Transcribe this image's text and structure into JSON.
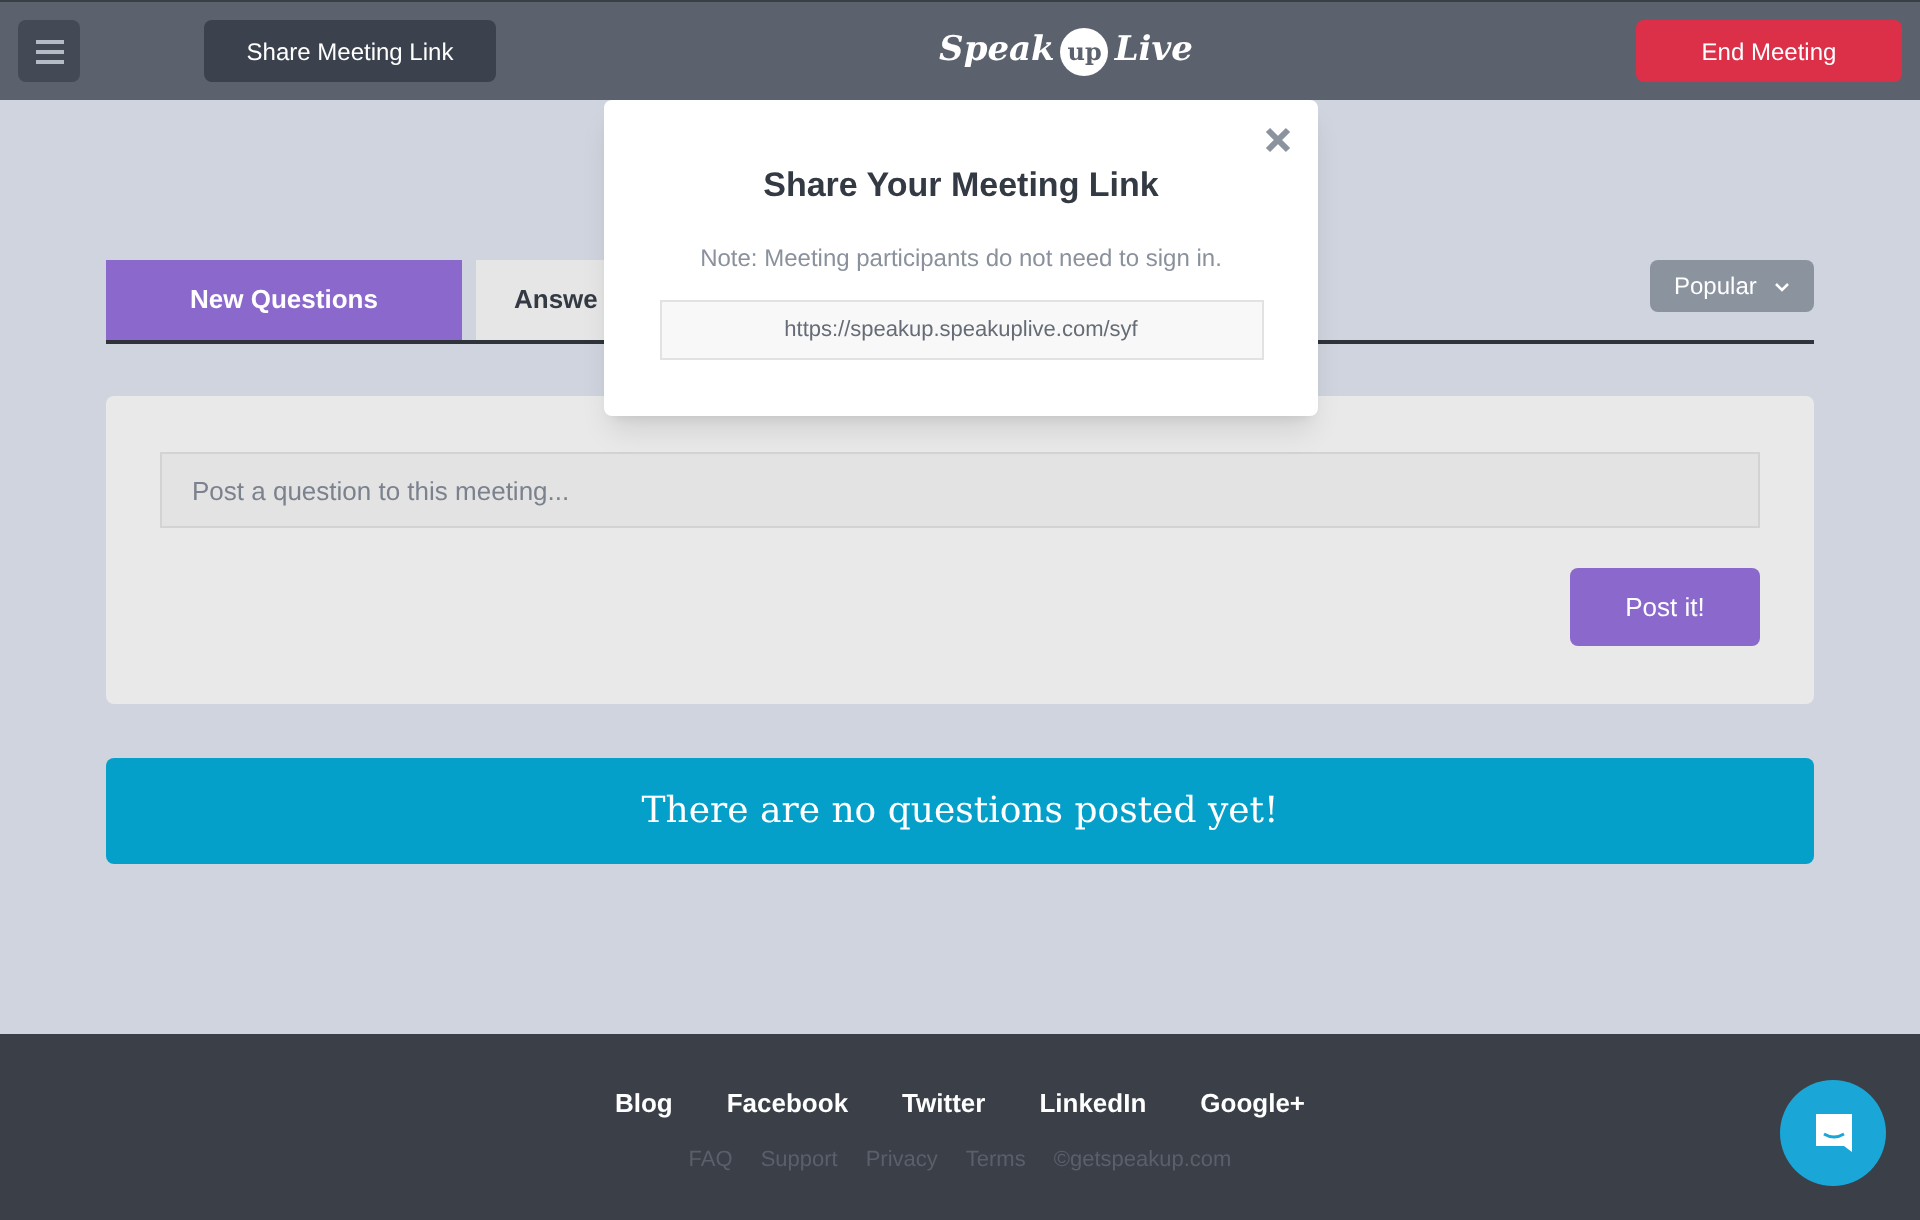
{
  "header": {
    "share_button": "Share Meeting Link",
    "logo": {
      "left": "Speak",
      "bubble": "up",
      "right": "Live"
    },
    "end_button": "End Meeting"
  },
  "tabs": [
    {
      "label": "New Questions",
      "selected": true
    },
    {
      "label": "Answe",
      "selected": false
    }
  ],
  "sort": {
    "value": "Popular"
  },
  "composer": {
    "placeholder": "Post a question to this meeting...",
    "submit": "Post it!"
  },
  "empty_notice": "There are no questions posted yet!",
  "modal": {
    "title": "Share Your Meeting Link",
    "note": "Note: Meeting participants do not need to sign in.",
    "link": "https://speakup.speakuplive.com/syf"
  },
  "footer": {
    "links": [
      "Blog",
      "Facebook",
      "Twitter",
      "LinkedIn",
      "Google+"
    ],
    "secondary_links": [
      "FAQ",
      "Support",
      "Privacy",
      "Terms",
      "©getspeakup.com"
    ]
  }
}
